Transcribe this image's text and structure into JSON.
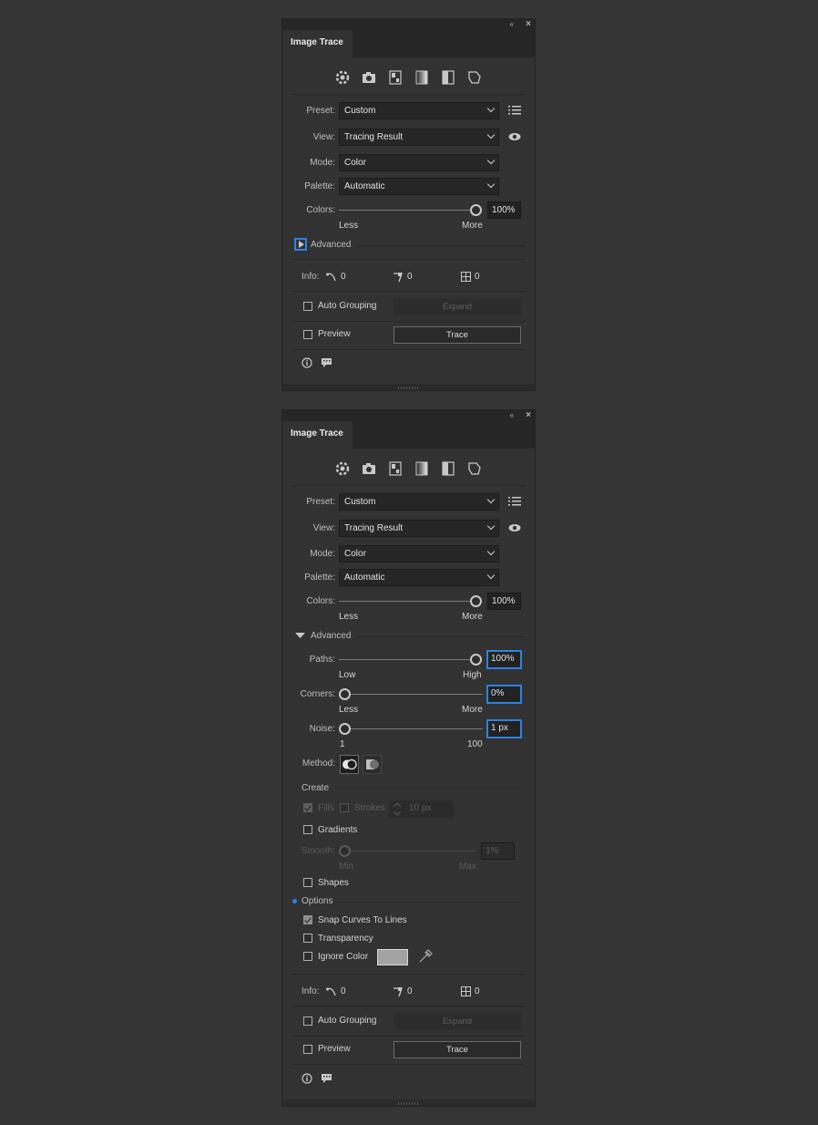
{
  "panel1": {
    "tab": "Image Trace",
    "preset": {
      "label": "Preset:",
      "value": "Custom"
    },
    "view": {
      "label": "View:",
      "value": "Tracing Result"
    },
    "mode": {
      "label": "Mode:",
      "value": "Color"
    },
    "palette": {
      "label": "Palette:",
      "value": "Automatic"
    },
    "colors": {
      "label": "Colors:",
      "value": "100%",
      "min": "Less",
      "max": "More",
      "level": 1.0
    },
    "advanced": "Advanced",
    "info": {
      "label": "Info:",
      "paths": "0",
      "anchors": "0",
      "colors": "0"
    },
    "auto_grouping": "Auto Grouping",
    "expand": "Expand",
    "preview": "Preview",
    "trace": "Trace"
  },
  "panel2": {
    "tab": "Image Trace",
    "preset": {
      "label": "Preset:",
      "value": "Custom"
    },
    "view": {
      "label": "View:",
      "value": "Tracing Result"
    },
    "mode": {
      "label": "Mode:",
      "value": "Color"
    },
    "palette": {
      "label": "Palette:",
      "value": "Automatic"
    },
    "colors": {
      "label": "Colors:",
      "value": "100%",
      "min": "Less",
      "max": "More",
      "level": 1.0
    },
    "advanced": "Advanced",
    "paths": {
      "label": "Paths:",
      "value": "100%",
      "min": "Low",
      "max": "High",
      "level": 1.0
    },
    "corners": {
      "label": "Corners:",
      "value": "0%",
      "min": "Less",
      "max": "More",
      "level": 0.0
    },
    "noise": {
      "label": "Noise:",
      "value": "1 px",
      "min": "1",
      "max": "100",
      "level": 0.0
    },
    "method": "Method:",
    "create": "Create",
    "fills": "Fills",
    "strokes": "Strokes",
    "stroke_width": "10 px",
    "gradients": "Gradients",
    "smooth": {
      "label": "Smooth:",
      "value": "1%",
      "min": "Min",
      "max": "Max",
      "level": 0.0
    },
    "shapes": "Shapes",
    "options": "Options",
    "snap_curves": "Snap Curves To Lines",
    "transparency": "Transparency",
    "ignore_color": "Ignore Color",
    "info": {
      "label": "Info:",
      "paths": "0",
      "anchors": "0",
      "colors": "0"
    },
    "auto_grouping": "Auto Grouping",
    "expand": "Expand",
    "preview": "Preview",
    "trace": "Trace"
  },
  "icons": {
    "collapse": "«",
    "close": "×",
    "presets": [
      "auto-color-icon",
      "high-color-icon",
      "low-color-icon",
      "grayscale-icon",
      "black-white-icon",
      "outline-icon"
    ]
  },
  "colors": {
    "focus": "#2c82e3",
    "panel": "#323232",
    "background": "#353535",
    "swatch": "#a3a3a3"
  }
}
